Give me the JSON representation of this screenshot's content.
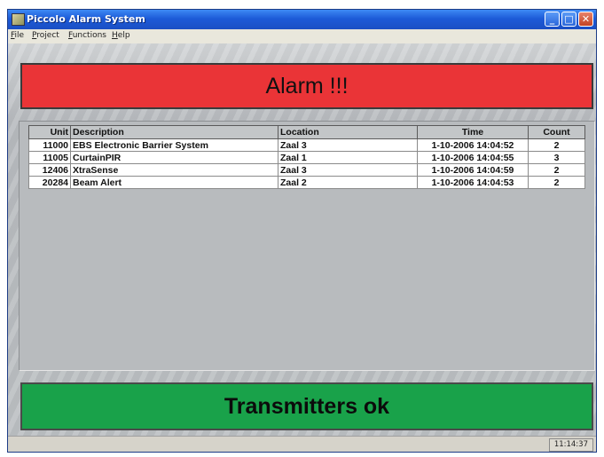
{
  "window": {
    "title": "Piccolo Alarm System"
  },
  "menu": [
    {
      "first": "F",
      "rest": "ile"
    },
    {
      "first": "P",
      "rest": "roject"
    },
    {
      "first": "F",
      "rest": "unctions"
    },
    {
      "first": "H",
      "rest": "elp"
    }
  ],
  "alarm_banner": {
    "text": "Alarm !!!",
    "color": "#ea3437"
  },
  "table": {
    "headers": {
      "unit": "Unit",
      "description": "Description",
      "location": "Location",
      "time": "Time",
      "count": "Count"
    },
    "rows": [
      {
        "unit": "11000",
        "description": "EBS Electronic Barrier System",
        "location": "Zaal 3",
        "time": "1-10-2006 14:04:52",
        "count": "2"
      },
      {
        "unit": "11005",
        "description": "CurtainPIR",
        "location": "Zaal 1",
        "time": "1-10-2006 14:04:55",
        "count": "3"
      },
      {
        "unit": "12406",
        "description": "XtraSense",
        "location": "Zaal 3",
        "time": "1-10-2006 14:04:59",
        "count": "2"
      },
      {
        "unit": "20284",
        "description": "Beam Alert",
        "location": "Zaal 2",
        "time": "1-10-2006 14:04:53",
        "count": "2"
      }
    ]
  },
  "status_banner": {
    "text": "Transmitters ok",
    "color": "#19a24a"
  },
  "statusbar": {
    "clock": "11:14:37"
  },
  "icons": [
    "app-icon",
    "minimize-icon",
    "maximize-icon",
    "close-icon"
  ]
}
